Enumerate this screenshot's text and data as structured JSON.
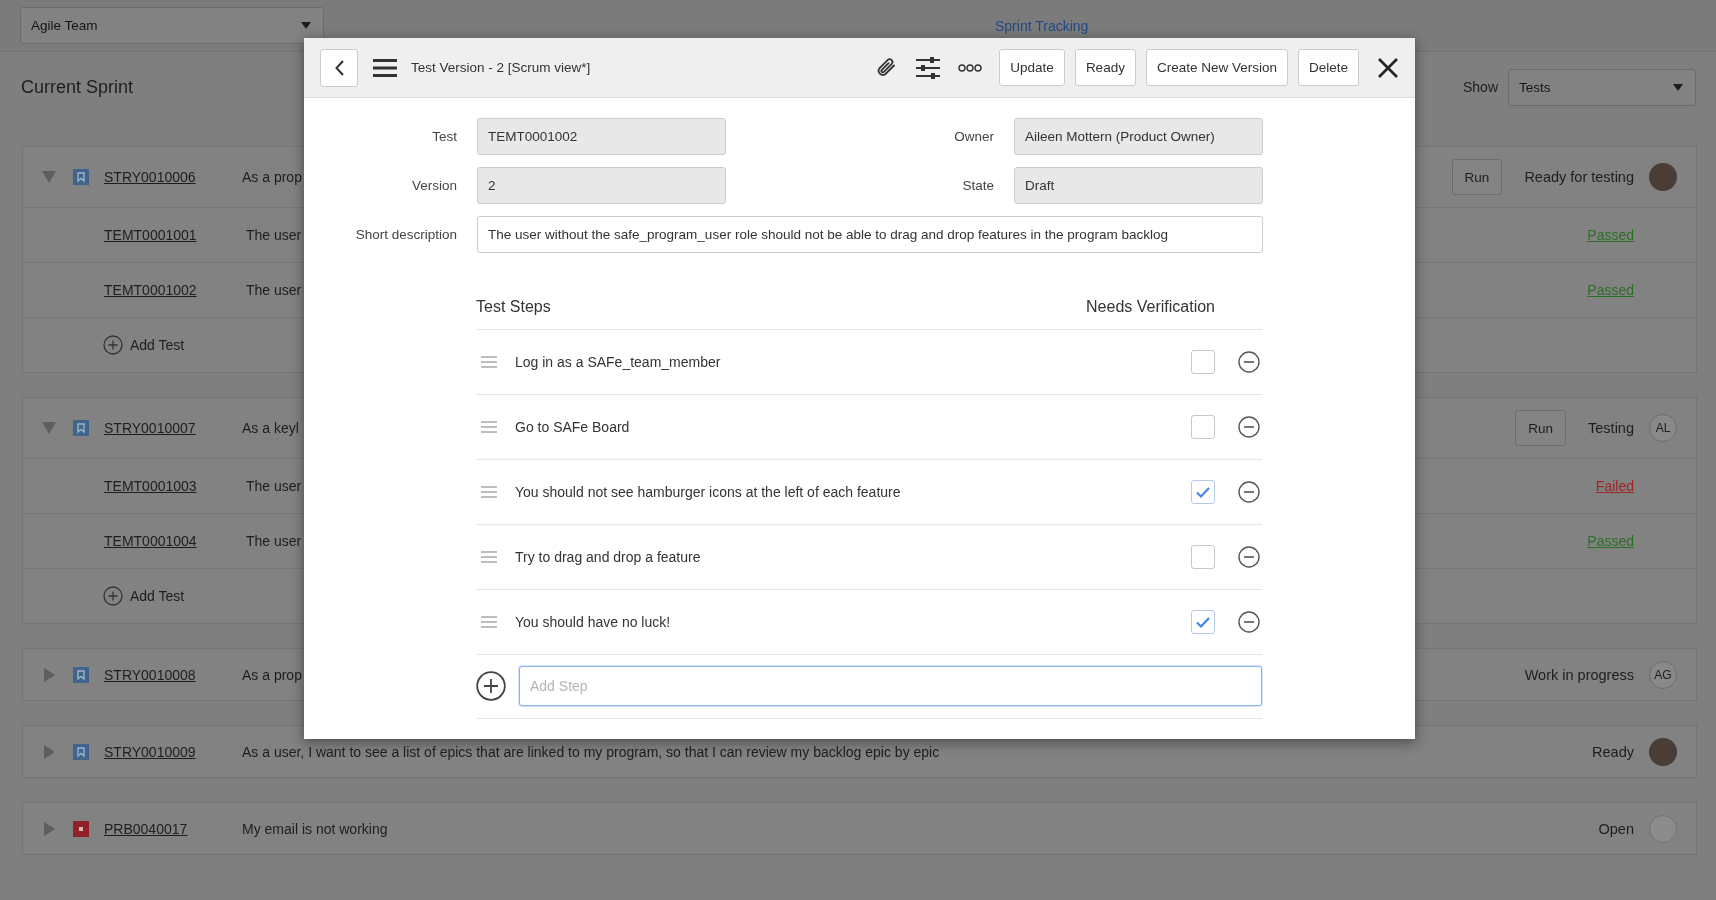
{
  "top_bar": {
    "team_select": {
      "value": "Agile Team"
    },
    "tabs": [
      {
        "label": "Sprint Tracking",
        "selected": true
      }
    ]
  },
  "header": {
    "title": "Current Sprint",
    "show_label": "Show",
    "show_select": {
      "value": "Tests"
    }
  },
  "stories": [
    {
      "kind": "story",
      "number": "STRY0010006",
      "expanded": true,
      "description": "As a prop",
      "run_button": "Run",
      "status": "Ready for testing",
      "avatar": {
        "kind": "photo"
      },
      "tests": [
        {
          "number": "TEMT0001001",
          "description": "The user",
          "result": "Passed",
          "color": "#2b6f26"
        },
        {
          "number": "TEMT0001002",
          "description": "The user",
          "result": "Passed",
          "color": "#2b6f26"
        }
      ],
      "add_test": "Add Test"
    },
    {
      "kind": "story",
      "number": "STRY0010007",
      "expanded": true,
      "description": "As a keyl",
      "run_button": "Run",
      "status": "Testing",
      "avatar": {
        "kind": "initials",
        "text": "AL"
      },
      "tests": [
        {
          "number": "TEMT0001003",
          "description": "The user",
          "result": "Failed",
          "color": "#9e2427"
        },
        {
          "number": "TEMT0001004",
          "description": "The user",
          "result": "Passed",
          "color": "#2b6f26"
        }
      ],
      "add_test": "Add Test"
    },
    {
      "kind": "story",
      "number": "STRY0010008",
      "expanded": false,
      "description": "As a prop",
      "status": "Work in progress",
      "avatar": {
        "kind": "initials",
        "text": "AG"
      }
    },
    {
      "kind": "story",
      "number": "STRY0010009",
      "expanded": false,
      "description": "As a user, I want to see a list of epics that are linked to my program, so that I can review my backlog epic by epic",
      "status": "Ready",
      "avatar": {
        "kind": "photo"
      }
    },
    {
      "kind": "problem",
      "number": "PRB0040017",
      "expanded": false,
      "description": "My email is not working",
      "status": "Open",
      "avatar": {
        "kind": "empty"
      }
    }
  ],
  "dialog": {
    "title": "Test Version - 2 [Scrum view*]",
    "buttons": [
      "Update",
      "Ready",
      "Create New Version",
      "Delete"
    ],
    "fields": [
      {
        "label": "Test",
        "value": "TEMT0001002",
        "readonly": true
      },
      {
        "label": "Owner",
        "value": "Aileen Mottern (Product Owner)",
        "readonly": true
      },
      {
        "label": "Version",
        "value": "2",
        "readonly": true
      },
      {
        "label": "State",
        "value": "Draft",
        "readonly": true
      }
    ],
    "short_description": {
      "label": "Short description",
      "value": "The user without the safe_program_user role should not be able to drag and drop features in the program backlog",
      "readonly": false
    },
    "steps_title": "Test Steps",
    "verification_title": "Needs Verification",
    "steps": [
      {
        "text": "Log in as a SAFe_team_member",
        "checked": false
      },
      {
        "text": "Go to SAFe Board",
        "checked": false
      },
      {
        "text": "You should not see hamburger icons at the left of each feature",
        "checked": true
      },
      {
        "text": "Try to drag and drop a feature",
        "checked": false
      },
      {
        "text": "You should have no luck!",
        "checked": true
      }
    ],
    "add_step": {
      "placeholder": "Add Step"
    }
  }
}
